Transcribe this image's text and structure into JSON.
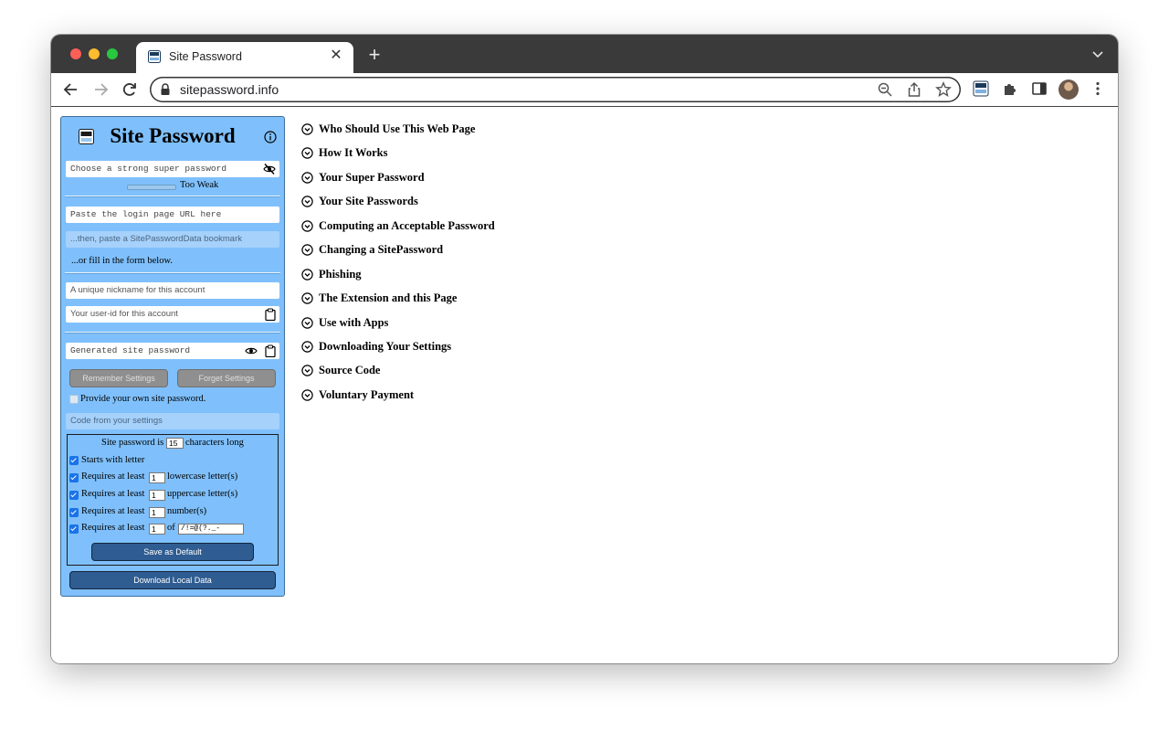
{
  "browser": {
    "tab_title": "Site Password",
    "url": "sitepassword.info"
  },
  "panel": {
    "title": "Site Password",
    "super_password_placeholder": "Choose a strong super password",
    "strength_label": "Too Weak",
    "url_placeholder": "Paste the login page URL here",
    "bookmark_placeholder": "...then, paste a SitePasswordData bookmark",
    "or_fill_text": "...or fill in the form below.",
    "nickname_placeholder": "A unique nickname for this account",
    "userid_placeholder": "Your user-id for this account",
    "generated_placeholder": "Generated site password",
    "remember_label": "Remember Settings",
    "forget_label": "Forget Settings",
    "provide_own_label": "Provide your own site password.",
    "code_placeholder": "Code from your settings",
    "settings": {
      "length_prefix": "Site password is",
      "length_value": "15",
      "length_suffix": "characters long",
      "starts_with_letter": "Starts with letter",
      "requires_prefix": "Requires at least",
      "lower_value": "1",
      "lower_suffix": "lowercase letter(s)",
      "upper_value": "1",
      "upper_suffix": "uppercase letter(s)",
      "number_value": "1",
      "number_suffix": "number(s)",
      "special_value": "1",
      "special_of": "of",
      "special_chars": "/!=@(?._-",
      "save_default_label": "Save as Default"
    },
    "download_label": "Download Local Data"
  },
  "faq": [
    "Who Should Use This Web Page",
    "How It Works",
    "Your Super Password",
    "Your Site Passwords",
    "Computing an Acceptable Password",
    "Changing a SitePassword",
    "Phishing",
    "The Extension and this Page",
    "Use with Apps",
    "Downloading Your Settings",
    "Source Code",
    "Voluntary Payment"
  ],
  "colors": {
    "panel_bg": "#7fc0fc",
    "button_blue": "#2f5c91",
    "button_gray": "#8f8f8f"
  }
}
